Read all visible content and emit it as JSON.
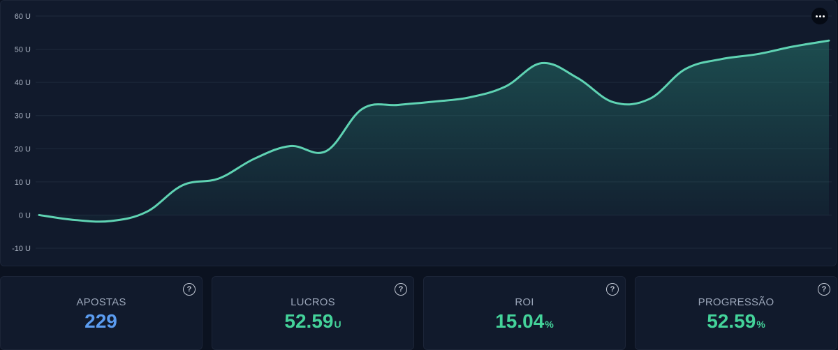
{
  "chart_data": {
    "type": "area",
    "title": "",
    "xlabel": "",
    "ylabel": "",
    "ylim": [
      -10,
      60
    ],
    "y_ticks": [
      "60 U",
      "50 U",
      "40 U",
      "30 U",
      "20 U",
      "10 U",
      "0 U",
      "-10 U"
    ],
    "y_tick_values": [
      60,
      50,
      40,
      30,
      20,
      10,
      0,
      -10
    ],
    "grid": true,
    "legend": "none",
    "x": [
      0,
      1,
      2,
      3,
      4,
      5,
      6,
      7,
      8,
      9,
      10,
      11,
      12,
      13,
      14,
      15,
      16,
      17,
      18,
      19,
      20,
      21,
      22,
      23
    ],
    "values": [
      0,
      -1.5,
      -1.8,
      1.0,
      9.0,
      11.0,
      17.0,
      20.8,
      19.3,
      32.0,
      33.2,
      34.2,
      35.5,
      38.8,
      45.8,
      41.3,
      34.0,
      35.0,
      44.0,
      47.0,
      48.5,
      50.8,
      52.6
    ],
    "line_color": "#5fd3b3",
    "fill_color": "#2a8a7a"
  },
  "menu": {
    "icon": "more-horizontal-icon"
  },
  "stats": [
    {
      "label": "APOSTAS",
      "value": "229",
      "unit": "",
      "color": "#5b9cf0"
    },
    {
      "label": "LUCROS",
      "value": "52.59",
      "unit": "U",
      "color": "#44d39a"
    },
    {
      "label": "ROI",
      "value": "15.04",
      "unit": "%",
      "color": "#44d39a"
    },
    {
      "label": "PROGRESSÃO",
      "value": "52.59",
      "unit": "%",
      "color": "#44d39a"
    }
  ],
  "help_icon": "?"
}
